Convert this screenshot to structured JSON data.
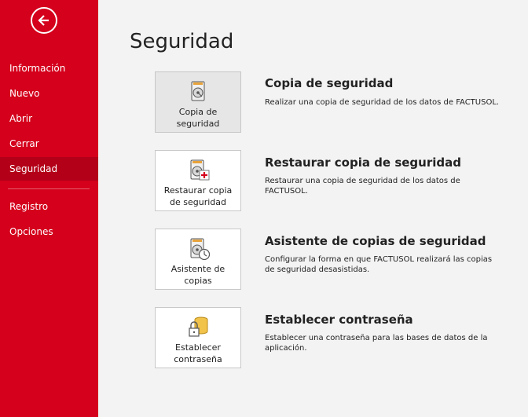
{
  "sidebar": {
    "back_icon": "back-arrow-icon",
    "items": [
      {
        "label": "Información"
      },
      {
        "label": "Nuevo"
      },
      {
        "label": "Abrir"
      },
      {
        "label": "Cerrar"
      },
      {
        "label": "Seguridad",
        "active": true
      },
      {
        "label": "Registro"
      },
      {
        "label": "Opciones"
      }
    ]
  },
  "colors": {
    "accent": "#d4001c",
    "accent_active": "#b30018",
    "background": "#f3f3f3"
  },
  "page": {
    "title": "Seguridad"
  },
  "actions": [
    {
      "tile_label": "Copia de seguridad",
      "icon": "backup-disk-icon",
      "title": "Copia de seguridad",
      "description": "Realizar una copia de seguridad de los datos de FACTUSOL."
    },
    {
      "tile_label": "Restaurar copia de seguridad",
      "icon": "restore-disk-icon",
      "title": "Restaurar copia de seguridad",
      "description": "Restaurar una copia de seguridad de los datos de FACTUSOL."
    },
    {
      "tile_label": "Asistente de copias",
      "icon": "backup-schedule-icon",
      "title": "Asistente de copias de seguridad",
      "description": "Configurar la forma en que FACTUSOL realizará las copias de seguridad desasistidas."
    },
    {
      "tile_label": "Establecer contraseña",
      "icon": "database-lock-icon",
      "title": "Establecer contraseña",
      "description": "Establecer una contraseña para las bases de datos de la aplicación."
    }
  ]
}
